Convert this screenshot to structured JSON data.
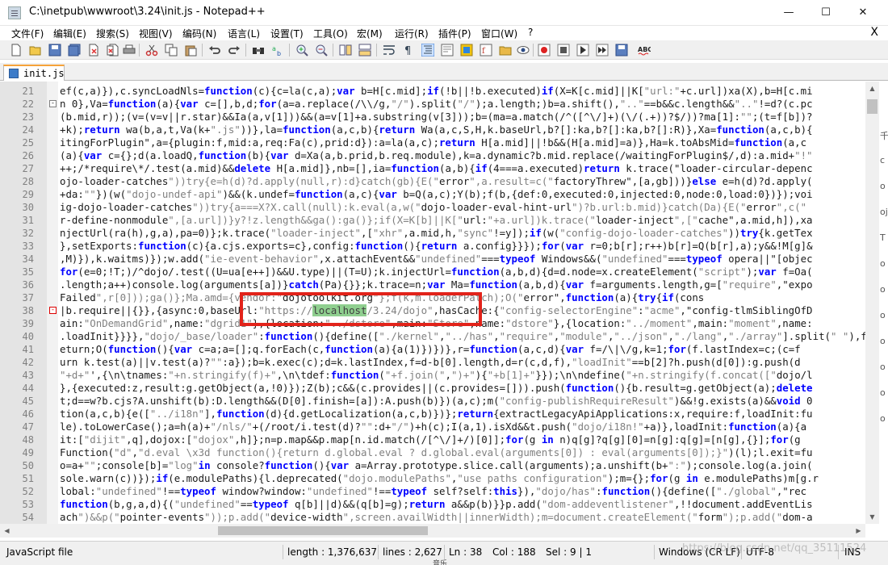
{
  "window": {
    "title": "C:\\inetpub\\wwwroot\\3.24\\init.js - Notepad++",
    "minimize": "—",
    "maximize": "☐",
    "close": "✕"
  },
  "menu": {
    "items": [
      "文件(F)",
      "编辑(E)",
      "搜索(S)",
      "视图(V)",
      "编码(N)",
      "语言(L)",
      "设置(T)",
      "工具(O)",
      "宏(M)",
      "运行(R)",
      "插件(P)",
      "窗口(W)",
      "?"
    ],
    "close_doc": "X"
  },
  "toolbar": {
    "icons": [
      "new-file",
      "open-file",
      "save",
      "save-all",
      "close",
      "close-all",
      "print",
      "cut",
      "copy",
      "paste",
      "undo",
      "redo",
      "find",
      "replace",
      "zoom-in",
      "zoom-out",
      "sync-vertical",
      "sync-horizontal",
      "word-wrap",
      "show-all-chars",
      "indent-guide",
      "define-language",
      "document-map",
      "function-list",
      "folder-workspace",
      "monitoring",
      "record-macro",
      "stop-record",
      "play-macro",
      "play-multiple",
      "save-macro",
      "spell-check"
    ]
  },
  "tab": {
    "label": "init.js"
  },
  "editor": {
    "lines": [
      {
        "n": "21",
        "fold": "",
        "code": "ef(c,a)}),c.syncLoadNls=function(c){c=la(c,a);var b=H[c.mid];if(!b||!b.executed)if(X=K[c.mid]||K[\"url:\"+c.url])xa(X),b=H[c.mi"
      },
      {
        "n": "22",
        "fold": "-",
        "code": "n 0},Va=function(a){var c=[],b,d;for(a=a.replace(/\\\\/g,\"/\").split(\"/\");a.length;)b=a.shift(),\"..\"==b&&c.length&&\"..\"!=d?(c.pc"
      },
      {
        "n": "23",
        "fold": "",
        "code": "(b.mid,r));(v=(v=v||r.star)&&Ia(a,v[1]))&&(a=v[1]+a.substring(v[3]));b=(ma=a.match(/^([^\\/]+)(\\/(.+))?$/))?ma[1]:\"\";(t=f[b])?"
      },
      {
        "n": "24",
        "fold": "",
        "code": "+k);return wa(b,a,t,Va(k+\".js\"))},la=function(a,c,b){return Wa(a,c,S,H,k.baseUrl,b?[]:ka,b?[]:ka,b?[]:R)},Xa=function(a,c,b){"
      },
      {
        "n": "25",
        "fold": "",
        "code": "itingForPlugin\",a={plugin:f,mid:a,req:Fa(c),prid:d}):a=la(a,c);return H[a.mid]||!b&&(H[a.mid]=a)},Ha=k.toAbsMid=function(a,c"
      },
      {
        "n": "26",
        "fold": "",
        "code": "(a){var c={};d(a.loadQ,function(b){var d=Xa(a,b.prid,b.req.module),k=a.dynamic?b.mid.replace(/waitingForPlugin$/,d):a.mid+\"!\""
      },
      {
        "n": "27",
        "fold": "",
        "code": "++;/*require\\*/.test(a.mid)&&delete H[a.mid]},nb=[],ia=function(a,b){if(4===a.executed)return k.trace(\"loader-circular-depenc"
      },
      {
        "n": "28",
        "fold": "",
        "code": "ojo-loader-catches\"))try{e=h(d)?d.apply(null,r):d}catch(gb){E(\"error\",a.result=c(\"factoryThrew\",[a,gb]))}else e=h(d)?d.apply("
      },
      {
        "n": "29",
        "fold": "",
        "code": "+da:\"\"})(w(\"dojo-undef-api\")&&(k.undef=function(a,c){var b=Q(a,c);Y(b);f(b,{def:0,executed:0,injected:0,node:0,load:0})});voi"
      },
      {
        "n": "30",
        "fold": "",
        "code": "ig-dojo-loader-catches\"))try{a===X?X.call(null):k.eval(a,w(\"dojo-loader-eval-hint-url\")?b.url:b.mid)}catch(Da){E(\"error\",c(\""
      },
      {
        "n": "31",
        "fold": "",
        "code": "r-define-nonmodule\",[a.url])}y?!z.length&&ga():ga()};if(X=K[b]||K[\"url:\"+a.url])k.trace(\"loader-inject\",[\"cache\",a.mid,h]),xa"
      },
      {
        "n": "32",
        "fold": "",
        "code": "njectUrl(ra(h),g,a),pa=0)};k.trace(\"loader-inject\",[\"xhr\",a.mid,h,\"sync\"!=y]);if(w(\"config-dojo-loader-catches\"))try{k.getTex"
      },
      {
        "n": "33",
        "fold": "",
        "code": "},setExports:function(c){a.cjs.exports=c},config:function(){return a.config}}});for(var r=0;b[r];r++)b[r]=Q(b[r],a);y&&!M[g]&"
      },
      {
        "n": "34",
        "fold": "",
        "code": ",M)}),k.waitms)});w.add(\"ie-event-behavior\",x.attachEvent&&\"undefined\"===typeof Windows&&(\"undefined\"===typeof opera||\"[objec"
      },
      {
        "n": "35",
        "fold": "",
        "code": "for(e=0;!T;)/^dojo/.test((U=ua[e++])&&U.type)||(T=U);k.injectUrl=function(a,b,d){d=d.node=x.createElement(\"script\");var f=Oa("
      },
      {
        "n": "36",
        "fold": "",
        "code": ".length;a++)console.log(arguments[a])}catch(Pa){}};k.trace=n;var Ma=function(a,b,d){var f=arguments.length,g=[\"require\",\"expo"
      },
      {
        "n": "37",
        "fold": "",
        "code": "Failed\",r[0]));ga()};Ma.amd={vendor:\"dojotoolkit.org\"};f(k,m.loaderPatch);O(\"error\",function(a){try{if(cons"
      },
      {
        "n": "38",
        "fold": "-",
        "code": "|b.require||{}},{async:0,baseUrl:\"https://localhost/3.24/dojo\",hasCache:{\"config-selectorEngine\":\"acme\",\"config-tlmSiblingOfD"
      },
      {
        "n": "39",
        "fold": "",
        "code": "ain:\"OnDemandGrid\",name:\"dgrid1\"},{location:\"../dstore\",main:\"Store\",name:\"dstore\"},{location:\"../moment\",main:\"moment\",name:"
      },
      {
        "n": "40",
        "fold": "",
        "code": ".loadInit}}}},\"dojo/_base/loader\":function(){define([\"./kernel\",\"../has\",\"require\",\"module\",\"../json\",\"./lang\",\"./array\"].split(\" \"),functi"
      },
      {
        "n": "41",
        "fold": "",
        "code": "eturn;O(function(){var c=a;a=[];q.forEach(c,function(a){a(1)})})},r=function(a,c,d){var f=/\\|\\/g,k=1;for(f.lastIndex=c;(c=f"
      },
      {
        "n": "42",
        "fold": "",
        "code": "urn k.test(a)||v.test(a)?\"\":a});b=k.exec(c);d=k.lastIndex,f=d-b[0].length,d=r(c,d,f),\"loadInit\"==b[2]?h.push(d[0]):g.push(d"
      },
      {
        "n": "43",
        "fold": "",
        "code": "\"+d+\"',{\\n\\tnames:\"+n.stringify(f)+\",\\n\\tdef:function(\"+f.join(\",\")+\"){\"+b[1]+\"}});\\n\\ndefine(\"+n.stringify(f.concat([\"dojo/l"
      },
      {
        "n": "44",
        "fold": "",
        "code": "},{executed:z,result:g.getObject(a,!0)});Z(b);c&&(c.provides||(c.provides=[])).push(function(){b.result=g.getObject(a);delete"
      },
      {
        "n": "45",
        "fold": "",
        "code": "t;d==w?b.cjs?A.unshift(b):D.length&&(D[0].finish=[a]):A.push(b)})(a,c);m(\"config-publishRequireResult\")&&!g.exists(a)&&void 0"
      },
      {
        "n": "46",
        "fold": "",
        "code": "tion(a,c,b){e([\"../i18n\"],function(d){d.getLocalization(a,c,b)})};return{extractLegacyApiApplications:x,require:f,loadInit:fu"
      },
      {
        "n": "47",
        "fold": "",
        "code": "le).toLowerCase();a=h(a)+\"/nls/\"+(/root/i.test(d)?\"\":d+\"/\")+h(c);I(a,1).isXd&&t.push(\"dojo/i18n!\"+a)},loadInit:function(a){a"
      },
      {
        "n": "48",
        "fold": "",
        "code": "it:[\"dijit\",q],dojox:[\"dojox\",h]};n=p.map&&p.map[n.id.match(/[^\\/]+/)[0]];for(g in n)q[g]?q[g][0]=n[g]:q[g]=[n[g],{}];for(g"
      },
      {
        "n": "49",
        "fold": "",
        "code": "Function(\"d\",\"d.eval \\x3d function(){return d.global.eval ? d.global.eval(arguments[0]) : eval(arguments[0]);}\")(l);l.exit=fu"
      },
      {
        "n": "50",
        "fold": "",
        "code": "o=a+\"\";console[b]=\"log\"in console?function(){var a=Array.prototype.slice.call(arguments);a.unshift(b+\":\");console.log(a.join("
      },
      {
        "n": "51",
        "fold": "",
        "code": "sole.warn(c))});if(e.modulePaths){l.deprecated(\"dojo.modulePaths\",\"use paths configuration\");m={};for(g in e.modulePaths)m[g.r"
      },
      {
        "n": "52",
        "fold": "",
        "code": "lobal:\"undefined\"!==typeof window?window:\"undefined\"!==typeof self?self:this}),\"dojo/has\":function(){define([\"./global\",\"rec"
      },
      {
        "n": "53",
        "fold": "",
        "code": "function(b,g,a,d){(\"undefined\"==typeof q[b]||d)&&(q[b]=g);return a&&p(b)}}p.add(\"dom-addeventlistener\",!!document.addEventLis"
      },
      {
        "n": "54",
        "fold": "",
        "code": "ach\")&&p(\"pointer-events\"));p.add(\"device-width\",screen.availWidth||innerWidth);m=document.createElement(\"form\");p.add(\"dom-a"
      }
    ],
    "highlight": "localhost"
  },
  "statusbar": {
    "filetype": "JavaScript file",
    "length": "length : 1,376,637",
    "lines": "lines : 2,627",
    "ln": "Ln : 38",
    "col": "Col : 188",
    "sel": "Sel : 9 | 1",
    "eol": "Windows (CR LF)",
    "encoding": "UTF-8",
    "mode": "INS"
  },
  "watermark": "https://blog.csdn.net/qq_35111524",
  "peek": [
    "千",
    "c",
    "o",
    "oj",
    "T",
    "o",
    "o",
    "o",
    "o",
    "o",
    "o",
    "o"
  ],
  "taskbar_peek": "音乐"
}
